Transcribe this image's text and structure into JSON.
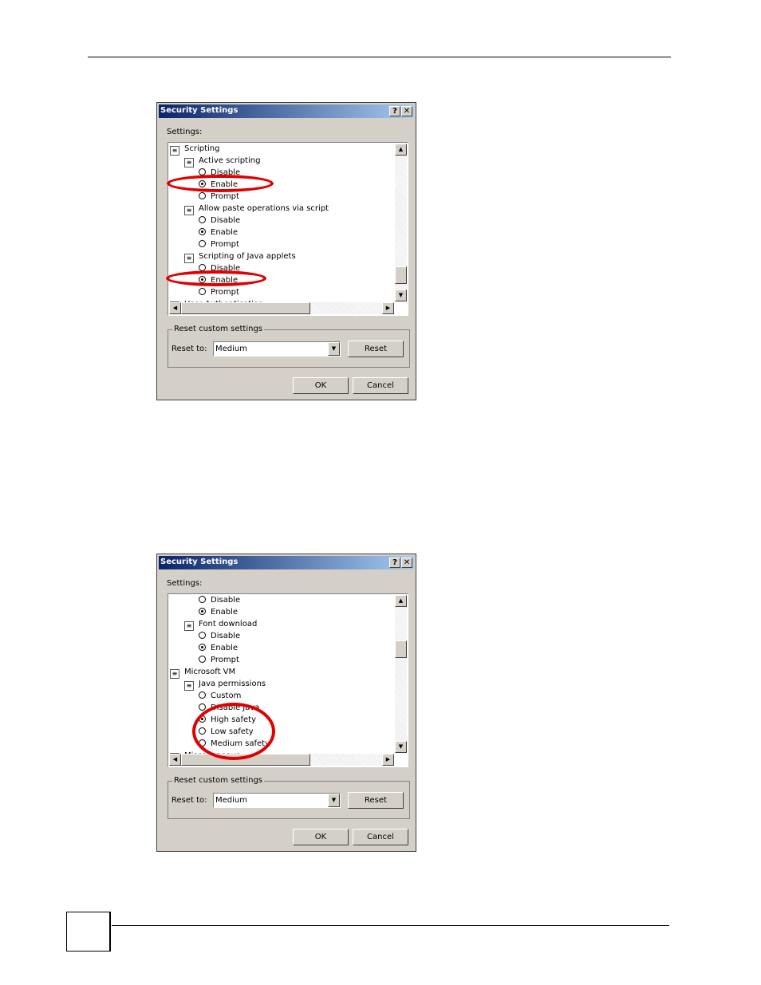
{
  "dialog1": {
    "title": "Security Settings",
    "help_btn": "?",
    "close_btn": "✕",
    "settings_label": "Settings:",
    "items": [
      {
        "kind": "category",
        "label": "Scripting"
      },
      {
        "kind": "subcategory",
        "label": "Active scripting"
      },
      {
        "kind": "option",
        "label": "Disable",
        "selected": false
      },
      {
        "kind": "option",
        "label": "Enable",
        "selected": true
      },
      {
        "kind": "option",
        "label": "Prompt",
        "selected": false
      },
      {
        "kind": "subcategory",
        "label": "Allow paste operations via script"
      },
      {
        "kind": "option",
        "label": "Disable",
        "selected": false
      },
      {
        "kind": "option",
        "label": "Enable",
        "selected": true
      },
      {
        "kind": "option",
        "label": "Prompt",
        "selected": false
      },
      {
        "kind": "subcategory",
        "label": "Scripting of Java applets"
      },
      {
        "kind": "option",
        "label": "Disable",
        "selected": false
      },
      {
        "kind": "option",
        "label": "Enable",
        "selected": true
      },
      {
        "kind": "option",
        "label": "Prompt",
        "selected": false
      },
      {
        "kind": "category",
        "label": "User Authentication"
      }
    ],
    "reset_group_label": "Reset custom settings",
    "reset_to_label": "Reset to:",
    "reset_to_value": "Medium",
    "reset_button": "Reset",
    "ok_button": "OK",
    "cancel_button": "Cancel"
  },
  "dialog2": {
    "title": "Security Settings",
    "help_btn": "?",
    "close_btn": "✕",
    "settings_label": "Settings:",
    "items": [
      {
        "kind": "option",
        "label": "Disable",
        "selected": false
      },
      {
        "kind": "option",
        "label": "Enable",
        "selected": true
      },
      {
        "kind": "subcategory",
        "label": "Font download"
      },
      {
        "kind": "option",
        "label": "Disable",
        "selected": false
      },
      {
        "kind": "option",
        "label": "Enable",
        "selected": true
      },
      {
        "kind": "option",
        "label": "Prompt",
        "selected": false
      },
      {
        "kind": "category",
        "label": "Microsoft VM"
      },
      {
        "kind": "subcategory",
        "label": "Java permissions"
      },
      {
        "kind": "option",
        "label": "Custom",
        "selected": false
      },
      {
        "kind": "option",
        "label": "Disable Java",
        "selected": false
      },
      {
        "kind": "option",
        "label": "High safety",
        "selected": true
      },
      {
        "kind": "option",
        "label": "Low safety",
        "selected": false
      },
      {
        "kind": "option",
        "label": "Medium safety",
        "selected": false
      },
      {
        "kind": "category",
        "label": "Miscellaneous"
      }
    ],
    "reset_group_label": "Reset custom settings",
    "reset_to_label": "Reset to:",
    "reset_to_value": "Medium",
    "reset_button": "Reset",
    "ok_button": "OK",
    "cancel_button": "Cancel"
  },
  "colors": {
    "highlight_ring": "#e00000",
    "titlebar": "#0a246a"
  }
}
